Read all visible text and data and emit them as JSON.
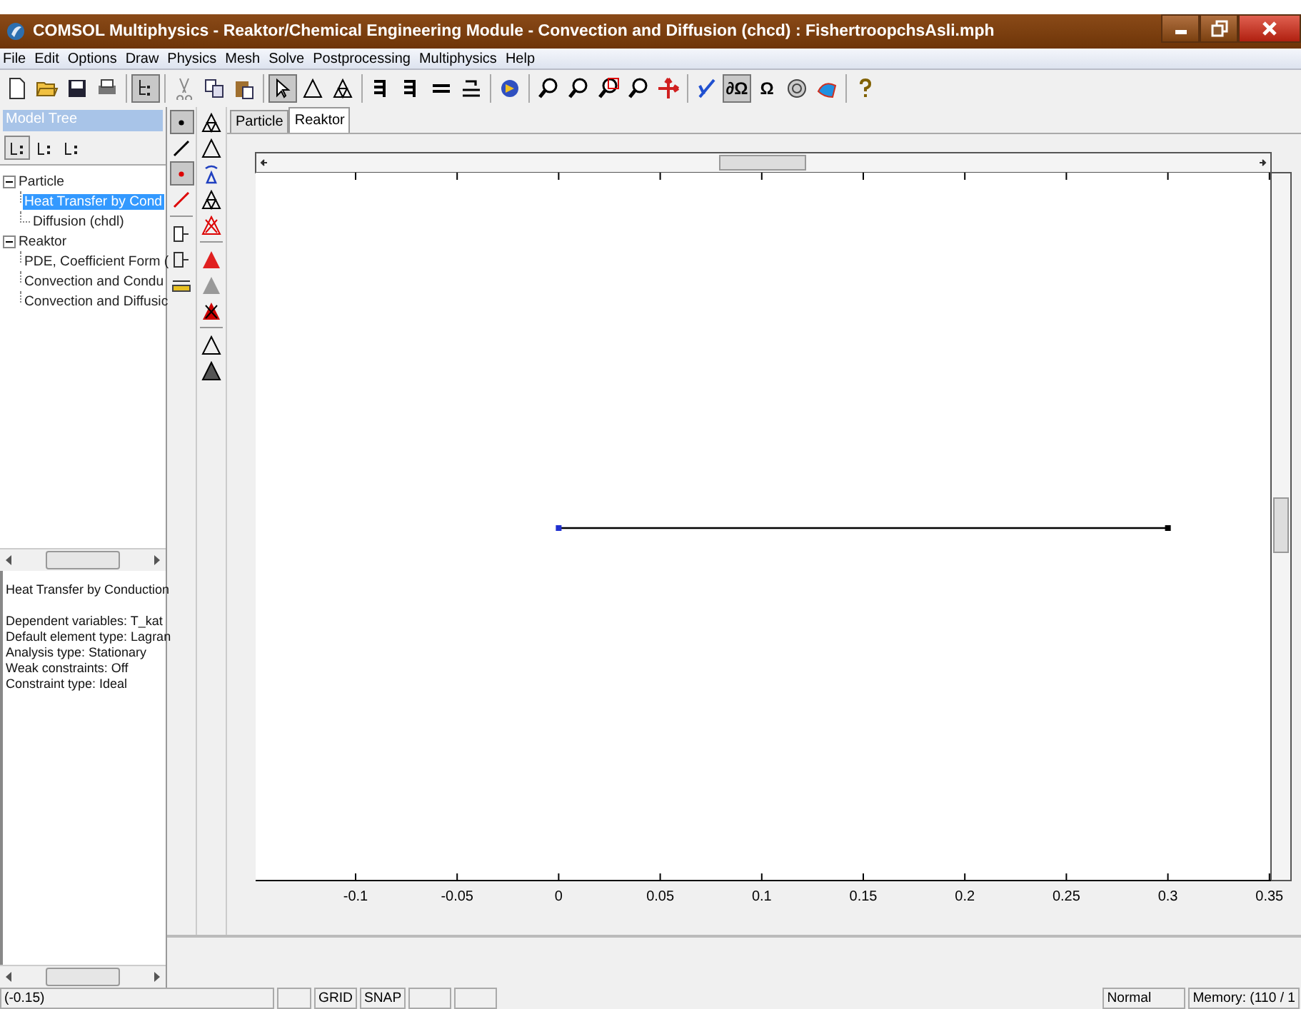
{
  "window": {
    "title": "COMSOL Multiphysics - Reaktor/Chemical Engineering Module - Convection and Diffusion (chcd) : FishertroopchsAsli.mph"
  },
  "menu": [
    "File",
    "Edit",
    "Options",
    "Draw",
    "Physics",
    "Mesh",
    "Solve",
    "Postprocessing",
    "Multiphysics",
    "Help"
  ],
  "toolbar": [
    {
      "kind": "new",
      "selected": false
    },
    {
      "kind": "open",
      "selected": false
    },
    {
      "kind": "save",
      "selected": false
    },
    {
      "kind": "print",
      "selected": false
    },
    {
      "kind": "sep"
    },
    {
      "kind": "tree",
      "selected": true
    },
    {
      "kind": "sep"
    },
    {
      "kind": "cut",
      "selected": false
    },
    {
      "kind": "copy",
      "selected": false
    },
    {
      "kind": "paste",
      "selected": false
    },
    {
      "kind": "sep"
    },
    {
      "kind": "pointer",
      "selected": true
    },
    {
      "kind": "triangle",
      "selected": false
    },
    {
      "kind": "triangles",
      "selected": false
    },
    {
      "kind": "sep"
    },
    {
      "kind": "bc",
      "selected": false
    },
    {
      "kind": "bc",
      "selected": false
    },
    {
      "kind": "equals",
      "selected": false
    },
    {
      "kind": "subdomain",
      "selected": false
    },
    {
      "kind": "sep"
    },
    {
      "kind": "solve",
      "selected": false
    },
    {
      "kind": "sep"
    },
    {
      "kind": "zoom",
      "selected": false
    },
    {
      "kind": "zoom",
      "selected": false
    },
    {
      "kind": "zoomwin",
      "selected": false
    },
    {
      "kind": "zoom",
      "selected": false
    },
    {
      "kind": "pan",
      "selected": false
    },
    {
      "kind": "sep"
    },
    {
      "kind": "pen",
      "selected": false
    },
    {
      "kind": "glyph",
      "label": "∂Ω",
      "selected": true
    },
    {
      "kind": "glyph",
      "label": "Ω",
      "selected": false
    },
    {
      "kind": "mesh",
      "selected": false
    },
    {
      "kind": "plot",
      "selected": false
    },
    {
      "kind": "sep"
    },
    {
      "kind": "help",
      "selected": false
    }
  ],
  "model_tree": {
    "title": "Model Tree",
    "view_buttons": [
      {
        "selected": true
      },
      {
        "selected": false
      },
      {
        "selected": false
      }
    ],
    "items": [
      {
        "label": "Particle",
        "expanded": true,
        "selected": false,
        "children": [
          {
            "label": "Heat Transfer by Cond",
            "selected": true
          },
          {
            "label": "Diffusion (chdl)",
            "selected": false
          }
        ]
      },
      {
        "label": "Reaktor",
        "expanded": true,
        "selected": false,
        "children": [
          {
            "label": "PDE, Coefficient Form (",
            "selected": false
          },
          {
            "label": "Convection and Condu",
            "selected": false
          },
          {
            "label": "Convection and Diffusic",
            "selected": false
          }
        ]
      }
    ]
  },
  "info_panel": {
    "heading": "Heat Transfer by Conduction",
    "lines": [
      "Dependent variables: T_kat",
      "Default element type: Lagran",
      "Analysis type: Stationary",
      "Weak constraints: Off",
      "Constraint type: Ideal"
    ]
  },
  "draw_tools_left": [
    {
      "kind": "point",
      "selected": true
    },
    {
      "kind": "line",
      "selected": false
    },
    {
      "kind": "point-red",
      "selected": true
    },
    {
      "kind": "line-red",
      "selected": false
    },
    {
      "kind": "sep"
    },
    {
      "kind": "export",
      "selected": false
    },
    {
      "kind": "import",
      "selected": false
    },
    {
      "kind": "ruler",
      "selected": false
    }
  ],
  "draw_tools_right": [
    {
      "kind": "tri-split"
    },
    {
      "kind": "tri"
    },
    {
      "kind": "tri-rotate"
    },
    {
      "kind": "tri-mesh"
    },
    {
      "kind": "tri-delete"
    },
    {
      "kind": "sep"
    },
    {
      "kind": "tri-red"
    },
    {
      "kind": "tri-grey"
    },
    {
      "kind": "tri-red-delete"
    },
    {
      "kind": "sep"
    },
    {
      "kind": "tri-outline"
    },
    {
      "kind": "tri-dark"
    }
  ],
  "tabs": [
    {
      "label": "Particle",
      "selected": false
    },
    {
      "label": "Reaktor",
      "selected": true
    }
  ],
  "geometry": {
    "x_tick_labels": [
      "-0.1",
      "-0.05",
      "0",
      "0.05",
      "0.1",
      "0.15",
      "0.2",
      "0.25",
      "0.3",
      "0.35"
    ]
  },
  "status_bar": {
    "coordinates": "(-0.15)",
    "grid": "GRID",
    "snap": "SNAP",
    "mode": "Normal",
    "memory": "Memory: (110 / 1"
  }
}
